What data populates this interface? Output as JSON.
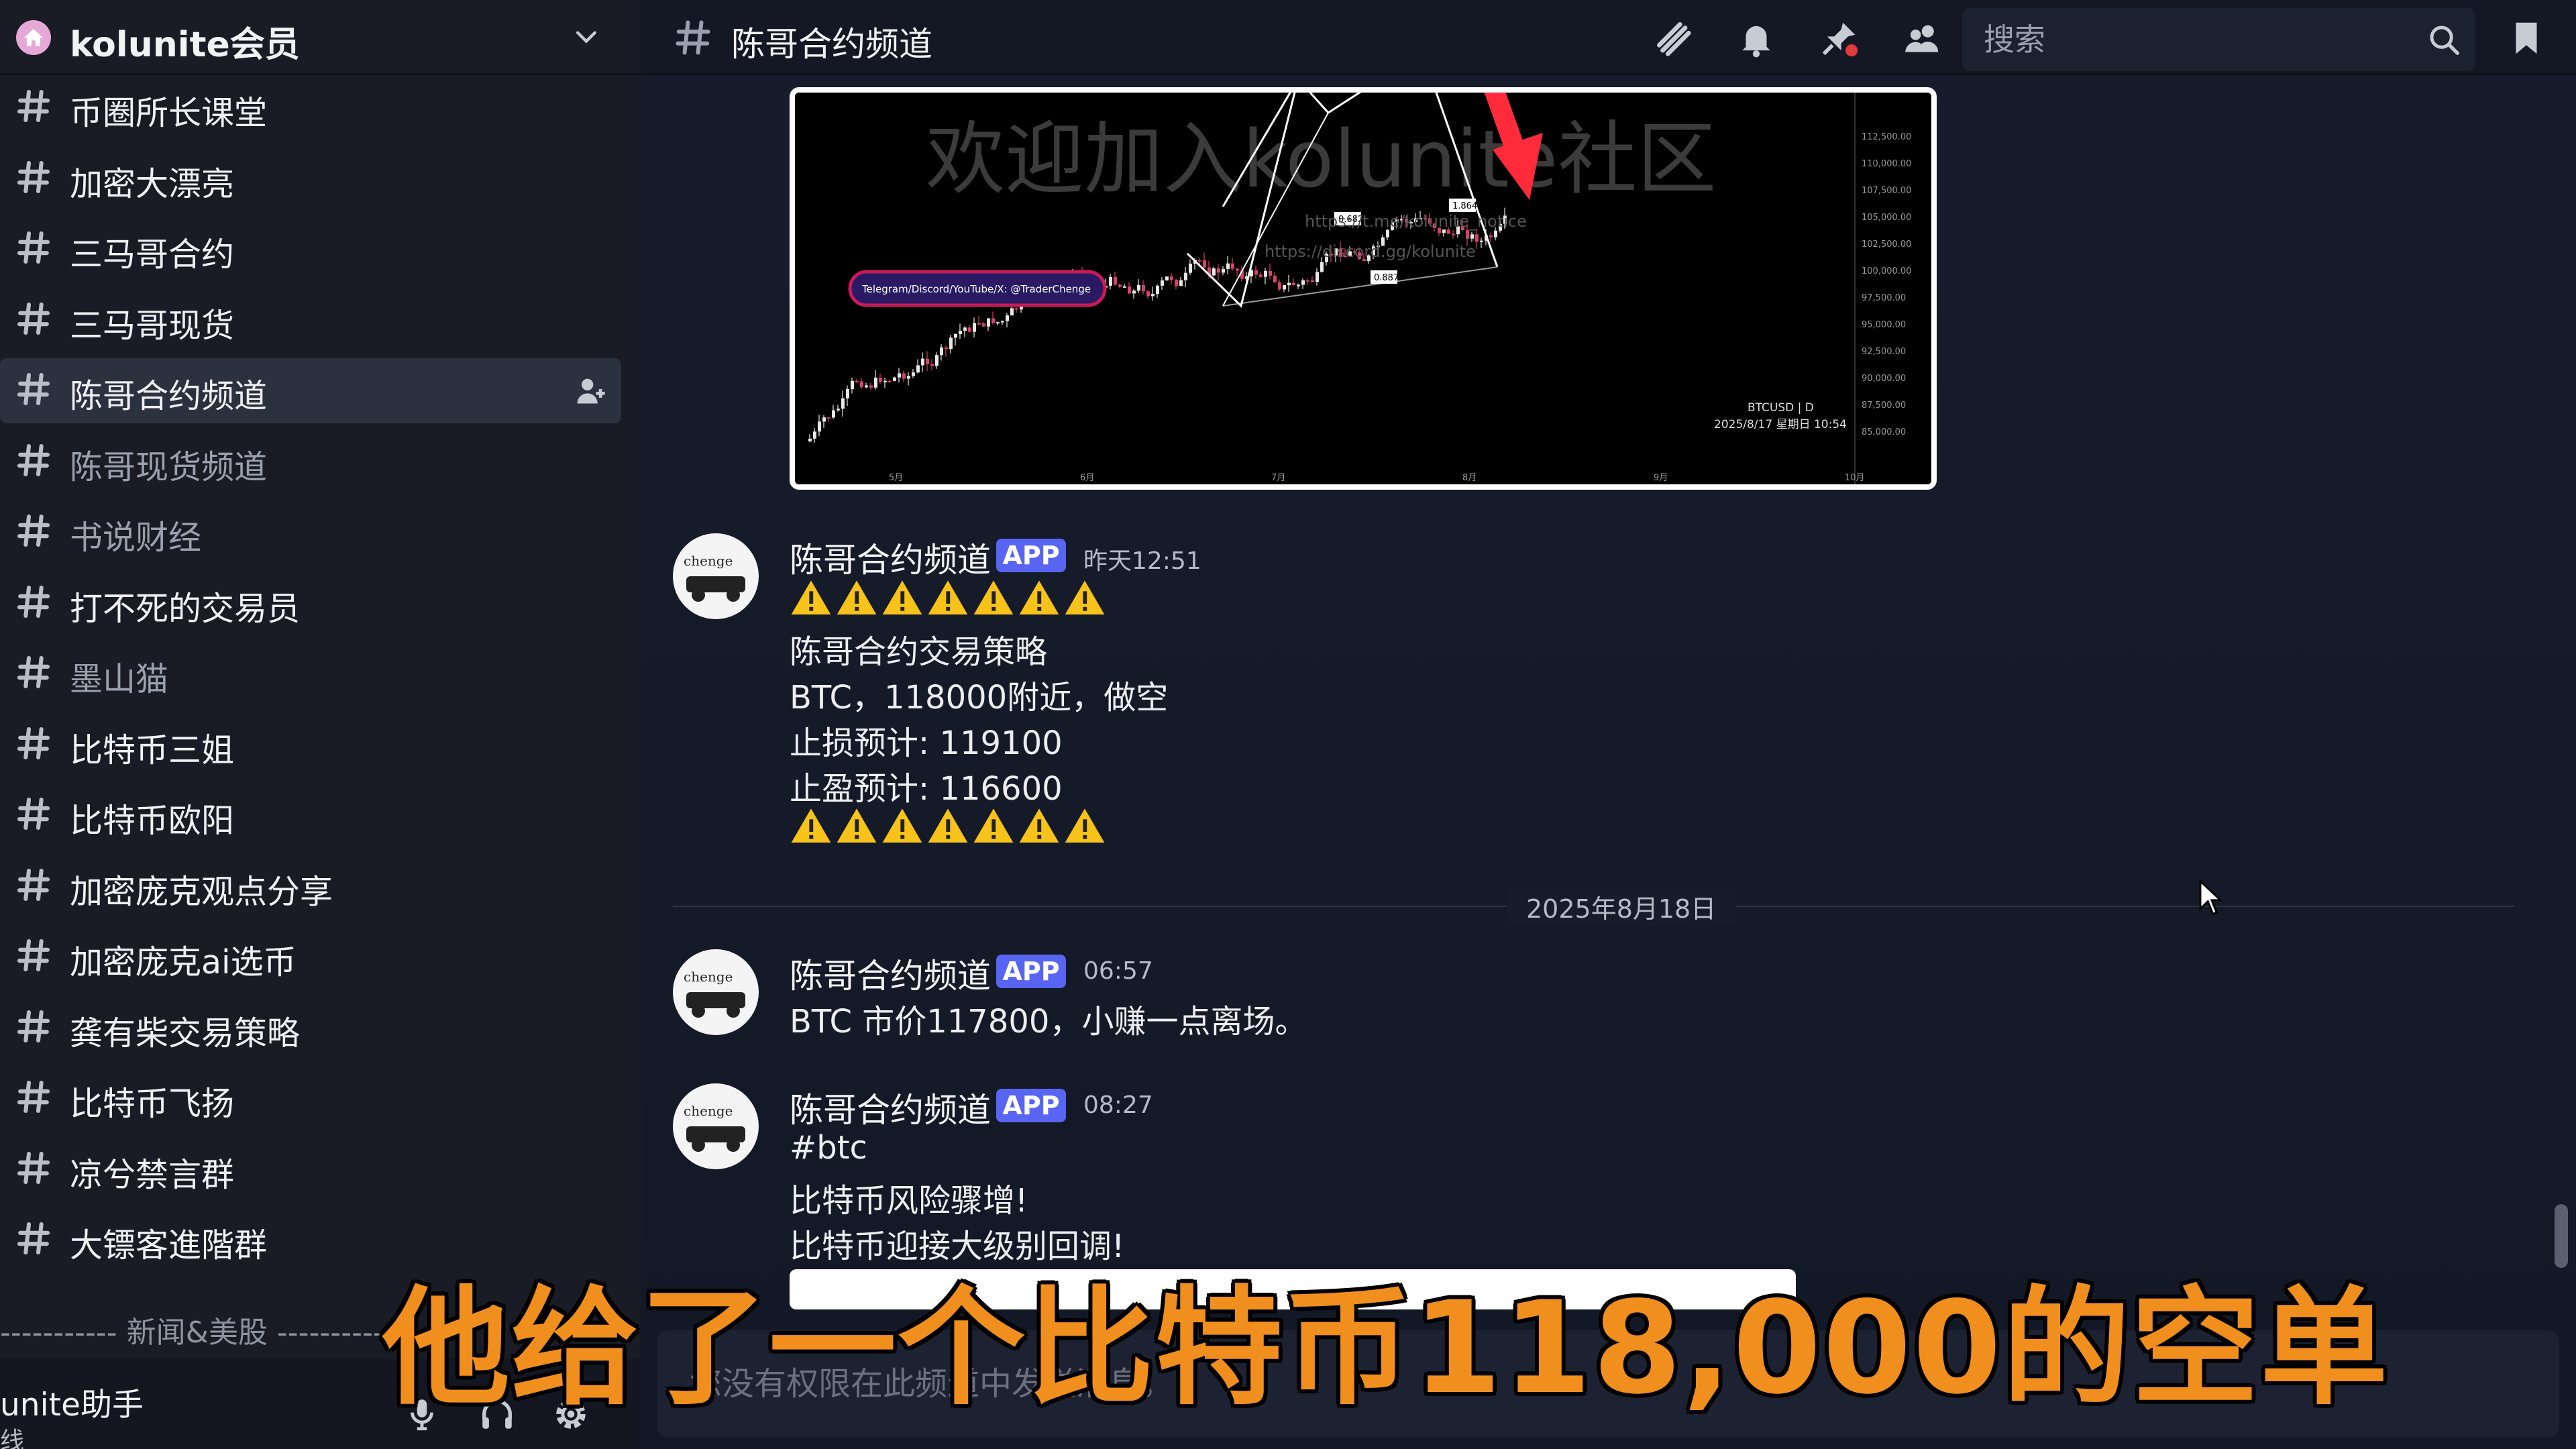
{
  "server": {
    "name": "kolunite会员"
  },
  "channels": [
    {
      "label": "币圈所长课堂",
      "dim": false,
      "active": false
    },
    {
      "label": "加密大漂亮",
      "dim": false,
      "active": false
    },
    {
      "label": "三马哥合约",
      "dim": false,
      "active": false
    },
    {
      "label": "三马哥现货",
      "dim": false,
      "active": false
    },
    {
      "label": "陈哥合约频道",
      "dim": false,
      "active": true
    },
    {
      "label": "陈哥现货频道",
      "dim": true,
      "active": false
    },
    {
      "label": "书说财经",
      "dim": true,
      "active": false
    },
    {
      "label": "打不死的交易员",
      "dim": false,
      "active": false
    },
    {
      "label": "墨山猫",
      "dim": true,
      "active": false
    },
    {
      "label": "比特币三姐",
      "dim": false,
      "active": false
    },
    {
      "label": "比特币欧阳",
      "dim": false,
      "active": false
    },
    {
      "label": "加密庞克观点分享",
      "dim": false,
      "active": false
    },
    {
      "label": "加密庞克ai选币",
      "dim": false,
      "active": false
    },
    {
      "label": "龚有柴交易策略",
      "dim": false,
      "active": false
    },
    {
      "label": "比特币飞扬",
      "dim": false,
      "active": false
    },
    {
      "label": "凉兮禁言群",
      "dim": false,
      "active": false
    },
    {
      "label": "大镖客進階群",
      "dim": false,
      "active": false
    }
  ],
  "category_divider": "----------- 新闻&美股 -----------",
  "user": {
    "name": "unite助手",
    "status": "线"
  },
  "topbar": {
    "channel_title": "陈哥合约频道",
    "search_placeholder": "搜索"
  },
  "chart_image": {
    "watermark": "欢迎加入kolunite社区",
    "banner": "Telegram/Discord/YouTube/X: @TraderChenge",
    "symbol": "BTCUSD | D",
    "date": "2025/8/17 星期日 10:54",
    "link1": "https://t.me/kolunite_notice",
    "link2": "https://discord.gg/kolunite",
    "fib1": "0.682",
    "fib2": "1.864",
    "fib3": "0.887",
    "price_labels": [
      "112,500.00",
      "110,000.00",
      "107,500.00",
      "105,000.00",
      "102,500.00",
      "100,000.00",
      "97,500.00",
      "95,000.00",
      "92,500.00",
      "90,000.00",
      "87,500.00",
      "85,000.00"
    ],
    "month_labels": [
      "5月",
      "6月",
      "7月",
      "8月",
      "9月",
      "10月"
    ]
  },
  "messages": [
    {
      "author": "陈哥合约频道",
      "badge": "APP",
      "time": "昨天12:51",
      "lines": [
        "陈哥合约交易策略",
        "BTC，118000附近，做空",
        "止损预计: 119100",
        "止盈预计: 116600"
      ]
    },
    {
      "author": "陈哥合约频道",
      "badge": "APP",
      "time": "06:57",
      "lines": [
        "BTC 市价117800，小赚一点离场。"
      ]
    },
    {
      "author": "陈哥合约频道",
      "badge": "APP",
      "time": "08:27",
      "lines": [
        "#btc",
        "比特币风险骤增!",
        "比特币迎接大级别回调!"
      ]
    }
  ],
  "date_divider": "2025年8月18日",
  "avatar_text": "chenge",
  "composer": {
    "placeholder": "您没有权限在此频道中发送消息。"
  },
  "caption": "他给了一个比特币118,000的空单",
  "colors": {
    "sidebar": "#191c25",
    "chat": "#161b2a",
    "badge": "#5865f2",
    "caption": "#f18f1e",
    "active_channel": "#2c3140"
  }
}
